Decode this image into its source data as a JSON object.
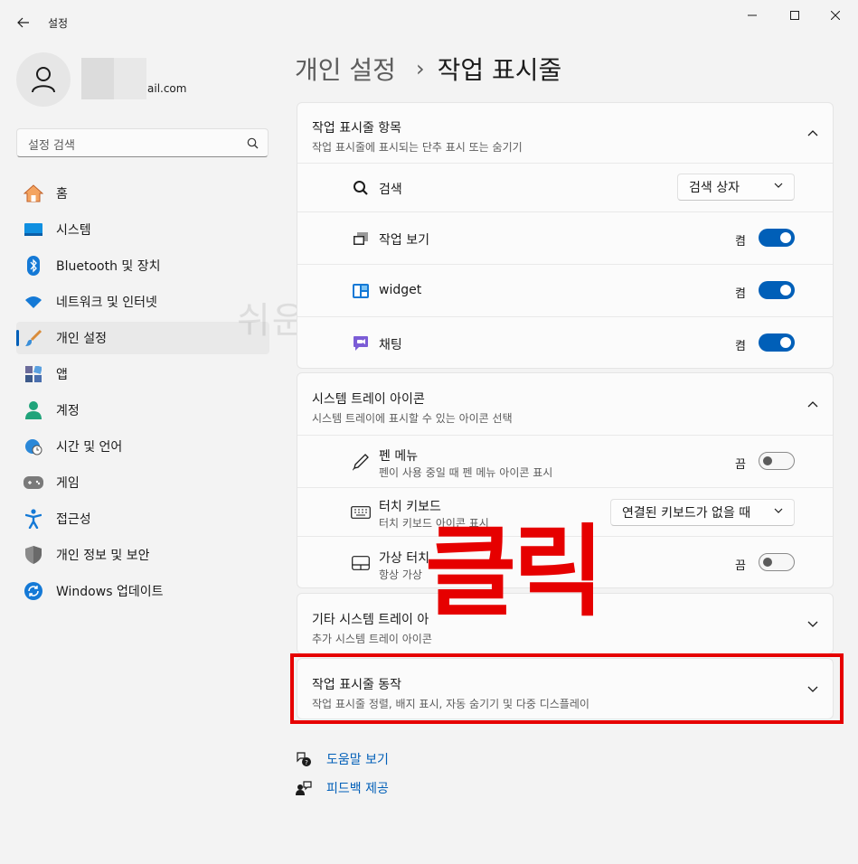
{
  "titlebar": {
    "app_title": "설정"
  },
  "profile": {
    "email_suffix": "ail.com"
  },
  "search": {
    "placeholder": "설정 검색"
  },
  "sidebar": {
    "items": [
      {
        "label": "홈"
      },
      {
        "label": "시스템"
      },
      {
        "label": "Bluetooth 및 장치"
      },
      {
        "label": "네트워크 및 인터넷"
      },
      {
        "label": "개인 설정"
      },
      {
        "label": "앱"
      },
      {
        "label": "계정"
      },
      {
        "label": "시간 및 언어"
      },
      {
        "label": "게임"
      },
      {
        "label": "접근성"
      },
      {
        "label": "개인 정보 및 보안"
      },
      {
        "label": "Windows 업데이트"
      }
    ]
  },
  "breadcrumb": {
    "parent": "개인 설정",
    "separator": "›",
    "current": "작업 표시줄"
  },
  "taskbar_items": {
    "title": "작업 표시줄 항목",
    "subtitle": "작업 표시줄에 표시되는 단추 표시 또는 숨기기",
    "rows": [
      {
        "label": "검색",
        "dropdown": "검색 상자"
      },
      {
        "label": "작업 보기",
        "state": "켬"
      },
      {
        "label": "widget",
        "state": "켬"
      },
      {
        "label": "채팅",
        "state": "켬"
      }
    ]
  },
  "tray_icons": {
    "title": "시스템 트레이 아이콘",
    "subtitle": "시스템 트레이에 표시할 수 있는 아이콘 선택",
    "rows": [
      {
        "label": "펜 메뉴",
        "sub": "펜이 사용 중일 때 펜 메뉴 아이콘 표시",
        "state": "끔"
      },
      {
        "label": "터치 키보드",
        "sub": "터치 키보드 아이콘 표시",
        "dropdown": "연결된 키보드가 없을 때"
      },
      {
        "label": "가상 터치",
        "sub": "항상 가상",
        "state": "끔"
      }
    ]
  },
  "other_tray": {
    "title": "기타 시스템 트레이 아",
    "subtitle": "추가 시스템 트레이 아이콘"
  },
  "taskbar_behavior": {
    "title": "작업 표시줄 동작",
    "subtitle": "작업 표시줄 정렬, 배지 표시, 자동 숨기기 및 다중 디스플레이"
  },
  "help": {
    "get_help": "도움말 보기",
    "feedback": "피드백 제공"
  },
  "annotation": {
    "click_text": "클릭",
    "watermark": "쉬운쌤"
  },
  "colors": {
    "accent": "#005fb8",
    "annotation_red": "#e60000"
  }
}
